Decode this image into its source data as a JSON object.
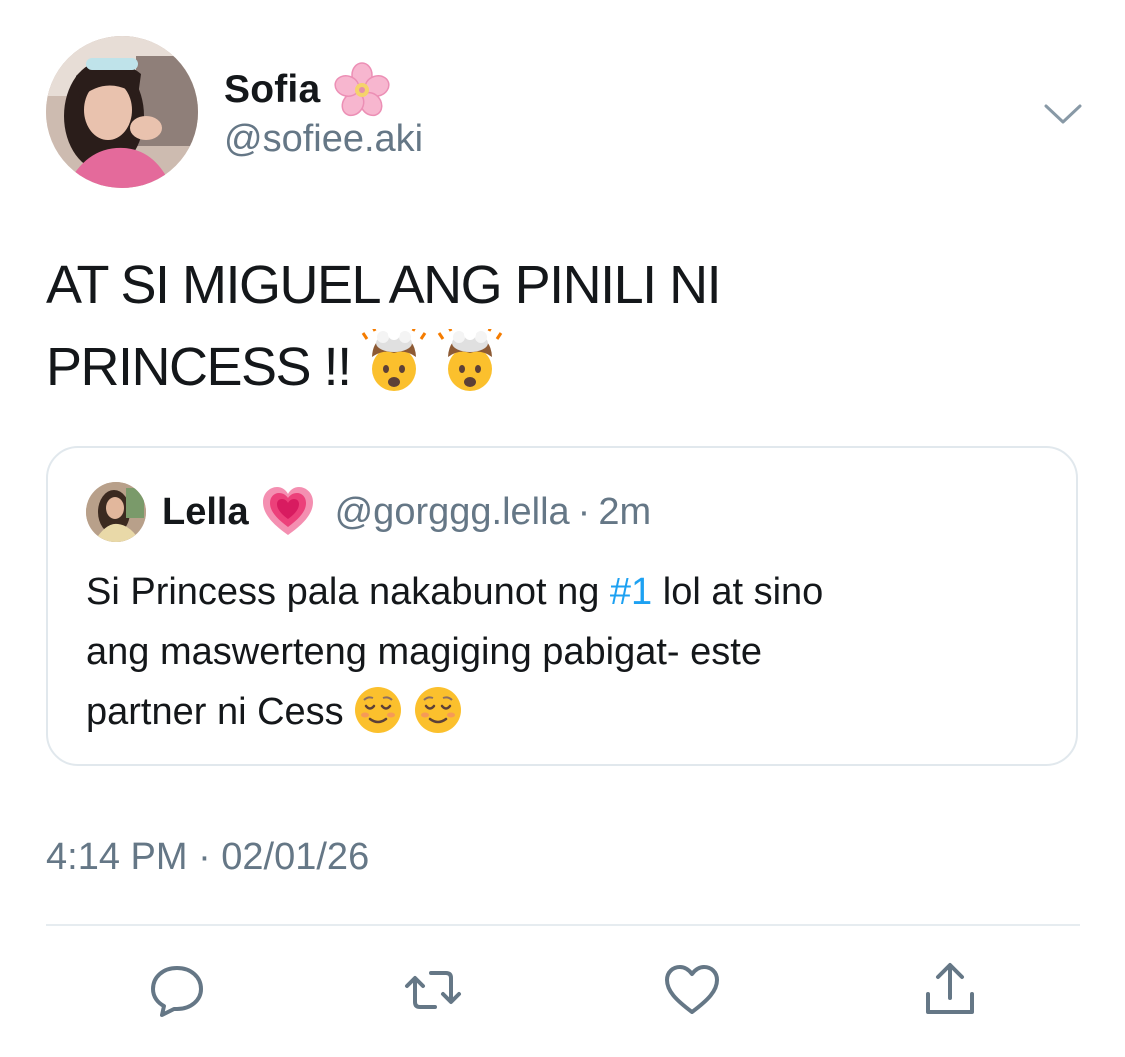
{
  "author": {
    "display_name": "Sofia",
    "name_emoji": "cherry-blossom-icon",
    "handle": "@sofiee.aki"
  },
  "tweet": {
    "text_line_1": "AT SI MIGUEL ANG PINILI NI",
    "text_line_2": "PRINCESS !!",
    "text_emojis": [
      "exploding-head-icon",
      "exploding-head-icon"
    ]
  },
  "quoted_tweet": {
    "display_name": "Lella",
    "name_emoji": "growing-heart-icon",
    "handle": "@gorggg.lella",
    "separator": "·",
    "time_ago": "2m",
    "line_1_before": "Si Princess pala nakabunot ng ",
    "line_1_hashtag": "#1",
    "line_1_after": " lol at sino",
    "line_2": "ang maswerteng magiging pabigat- este",
    "line_3": "partner ni Cess",
    "line_3_emojis": [
      "relieved-face-icon",
      "relieved-face-icon"
    ]
  },
  "timestamp": "4:14 PM · 02/01/26",
  "actions": [
    "reply-icon",
    "retweet-icon",
    "like-icon",
    "share-icon"
  ],
  "colors": {
    "text": "#14171a",
    "secondary": "#657786",
    "link": "#1da1f2",
    "border": "#e1e8ed"
  }
}
